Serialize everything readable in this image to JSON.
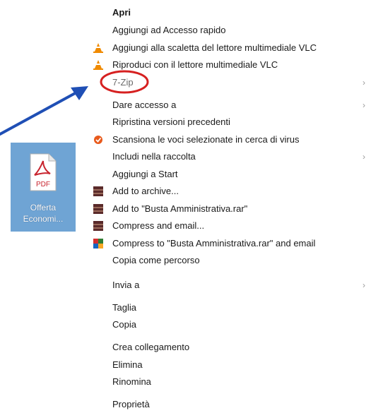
{
  "context_menu": {
    "items": [
      {
        "label": "Apri",
        "bold": true
      },
      {
        "label": "Aggiungi ad Accesso rapido"
      },
      {
        "label": "Aggiungi alla scaletta del lettore multimediale VLC",
        "icon": "vlc-cone-icon"
      },
      {
        "label": "Riproduci con il lettore multimediale VLC",
        "icon": "vlc-cone-icon"
      },
      {
        "label": "7-Zip",
        "submenu": true
      },
      {
        "label": "Dare accesso a",
        "submenu": true
      },
      {
        "label": "Ripristina versioni precedenti"
      },
      {
        "label": "Scansiona le voci selezionate in cerca di virus",
        "icon": "antivirus-icon"
      },
      {
        "label": "Includi nella raccolta",
        "submenu": true
      },
      {
        "label": "Aggiungi a Start"
      },
      {
        "label": "Add to archive...",
        "icon": "winrar-icon"
      },
      {
        "label": "Add to \"Busta Amministrativa.rar\"",
        "icon": "winrar-icon"
      },
      {
        "label": "Compress and email...",
        "icon": "winrar-icon"
      },
      {
        "label": "Compress to \"Busta Amministrativa.rar\" and email",
        "icon": "winrar-icon"
      },
      {
        "label": "Copia come percorso"
      },
      {
        "label": "Invia a",
        "submenu": true
      },
      {
        "label": "Taglia"
      },
      {
        "label": "Copia"
      },
      {
        "label": "Crea collegamento"
      },
      {
        "label": "Elimina"
      },
      {
        "label": "Rinomina"
      },
      {
        "label": "Proprietà"
      }
    ]
  },
  "file_icon": {
    "type_label": "PDF",
    "name_line1": "Offerta",
    "name_line2": "Economi..."
  },
  "colors": {
    "accent_selection": "#6fa4d4",
    "annotation_circle": "#d62020",
    "annotation_arrow": "#1f4fb5",
    "pdf_red": "#c8242e"
  }
}
